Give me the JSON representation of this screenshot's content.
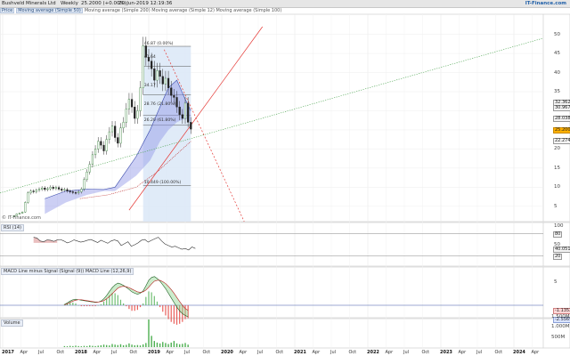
{
  "header": {
    "instrument": "Bushveld Minerals Ltd",
    "period": "Weekly",
    "quote": "25.2000 (+0.00%)",
    "datetime": "20-Jun-2019 12:19:36",
    "brand": "IT-Finance.com"
  },
  "legend": {
    "price_tag": "Price",
    "ma50_tag": "Moving average (Simple 50)",
    "mas_text": "Moving average (Simple 200) Moving average (Simple 12) Moving average (Simple 100)"
  },
  "main_panel": {
    "y_ticks": [
      "50",
      "45",
      "40",
      "35",
      "30",
      "25",
      "20",
      "15",
      "10",
      "5"
    ],
    "price_tags": [
      "32.3627",
      "30.9673",
      "28.0381",
      "25.2000",
      "22.2742"
    ],
    "fib_levels": [
      "46.87 (0.00%)",
      "41.64",
      "34.17",
      "28.76 (21.80%)",
      "26.20 (61.80%)",
      "10.449 (100.00%)"
    ],
    "watermark": "© IT-Finance.com"
  },
  "rsi_panel": {
    "label": "RSI (14)",
    "y_ticks": [
      "100",
      "50"
    ],
    "price_tags": [
      "80",
      "40.0511",
      "20"
    ],
    "series": [
      70,
      68,
      60,
      58,
      63,
      62,
      59,
      63,
      64,
      60,
      55,
      58,
      63,
      60,
      57,
      59,
      62,
      64,
      60,
      56,
      62,
      58,
      54,
      60,
      63,
      60,
      48,
      53,
      58,
      46,
      50,
      55,
      62,
      64,
      57,
      62,
      66,
      70,
      60,
      52,
      48,
      44,
      46,
      42,
      38,
      40,
      36,
      44,
      40
    ]
  },
  "macd_panel": {
    "label": "MACD Line minus Signal (Signal (9)) MACD Line (12,26,9)",
    "y_ticks": [
      "5"
    ],
    "price_tags": [
      "-1.1352",
      "-2.5569"
    ],
    "macd": [
      0.2,
      0.5,
      0.9,
      1.2,
      1.3,
      1.2,
      1.1,
      1.0,
      0.9,
      0.8,
      0.7,
      0.6,
      0.7,
      0.9,
      1.4,
      2.1,
      3.0,
      3.8,
      4.4,
      4.8,
      4.6,
      4.3,
      3.9,
      3.4,
      2.9,
      2.6,
      2.4,
      2.6,
      3.1,
      4.2,
      5.4,
      6.0,
      6.2,
      5.8,
      5.2,
      4.4,
      3.6,
      2.6,
      1.6,
      0.6,
      -0.4,
      -1.2,
      -1.8,
      -2.2,
      -2.5
    ],
    "signal": [
      0.1,
      0.3,
      0.6,
      0.9,
      1.1,
      1.2,
      1.2,
      1.1,
      1.0,
      0.9,
      0.8,
      0.7,
      0.7,
      0.8,
      1.0,
      1.4,
      1.9,
      2.5,
      3.1,
      3.7,
      4.0,
      4.1,
      4.0,
      3.8,
      3.5,
      3.2,
      2.9,
      2.8,
      2.9,
      3.3,
      3.9,
      4.6,
      5.2,
      5.4,
      5.4,
      5.1,
      4.7,
      4.1,
      3.4,
      2.6,
      1.7,
      0.8,
      0.0,
      -0.7,
      -1.1
    ]
  },
  "volume_panel": {
    "label": "Volume",
    "y_ticks": [
      "1.500M",
      "1.000M",
      "500M"
    ],
    "values": [
      0.05,
      0.04,
      0.06,
      0.05,
      0.07,
      0.05,
      0.04,
      0.06,
      0.05,
      0.08,
      0.06,
      0.05,
      0.07,
      0.09,
      0.12,
      0.1,
      0.08,
      0.15,
      0.12,
      0.1,
      0.14,
      0.09,
      0.11,
      0.18,
      0.12,
      0.09,
      0.1,
      0.08,
      0.13,
      0.2,
      1.35,
      0.55,
      0.3,
      0.22,
      0.18,
      0.25,
      0.2,
      0.15,
      0.22,
      0.3,
      0.18,
      0.14,
      0.16,
      0.2,
      0.12
    ]
  },
  "time_axis": {
    "labels": [
      {
        "text": "2017",
        "year": true
      },
      {
        "text": "Apr",
        "year": false
      },
      {
        "text": "Jul",
        "year": false
      },
      {
        "text": "Oct",
        "year": false
      },
      {
        "text": "2018",
        "year": true
      },
      {
        "text": "Apr",
        "year": false
      },
      {
        "text": "Jul",
        "year": false
      },
      {
        "text": "Oct",
        "year": false
      },
      {
        "text": "2019",
        "year": true
      },
      {
        "text": "Apr",
        "year": false
      },
      {
        "text": "Jul",
        "year": false
      },
      {
        "text": "Oct",
        "year": false
      },
      {
        "text": "2020",
        "year": true
      },
      {
        "text": "Apr",
        "year": false
      },
      {
        "text": "Jul",
        "year": false
      },
      {
        "text": "Oct",
        "year": false
      },
      {
        "text": "2021",
        "year": true
      },
      {
        "text": "Apr",
        "year": false
      },
      {
        "text": "Jul",
        "year": false
      },
      {
        "text": "Oct",
        "year": false
      },
      {
        "text": "2022",
        "year": true
      },
      {
        "text": "Apr",
        "year": false
      },
      {
        "text": "Jul",
        "year": false
      },
      {
        "text": "Oct",
        "year": false
      },
      {
        "text": "2023",
        "year": true
      },
      {
        "text": "Apr",
        "year": false
      },
      {
        "text": "Jul",
        "year": false
      },
      {
        "text": "Oct",
        "year": false
      },
      {
        "text": "2024",
        "year": true
      },
      {
        "text": "Apr",
        "year": false
      }
    ]
  },
  "price_series": {
    "closes": [
      2.5,
      3.0,
      3.2,
      3.5,
      6.0,
      8.5,
      9.0,
      8.8,
      9.2,
      9.5,
      9.8,
      9.4,
      9.6,
      10.0,
      9.7,
      9.9,
      9.5,
      9.2,
      9.4,
      9.0,
      8.8,
      8.6,
      8.5,
      8.8,
      9.5,
      12.0,
      14.0,
      16.0,
      18.5,
      20.0,
      22.0,
      21.0,
      19.5,
      22.5,
      24.5,
      26.0,
      23.0,
      21.5,
      25.5,
      27.0,
      30.5,
      33.0,
      31.0,
      28.0,
      30.0,
      36.0,
      47.0,
      44.0,
      43.0,
      41.0,
      38.0,
      40.5,
      39.0,
      37.0,
      38.5,
      36.0,
      34.0,
      33.5,
      31.0,
      29.0,
      28.0,
      32.0,
      27.0,
      25.2
    ]
  },
  "colors": {
    "up_candle": "#2e7d32",
    "down_candle": "#222222",
    "fib_zone": "#dbe7f7",
    "ma_fill": "#8f95e6",
    "resistance_line": "#e53935",
    "trend_dotted": "#43a047"
  }
}
